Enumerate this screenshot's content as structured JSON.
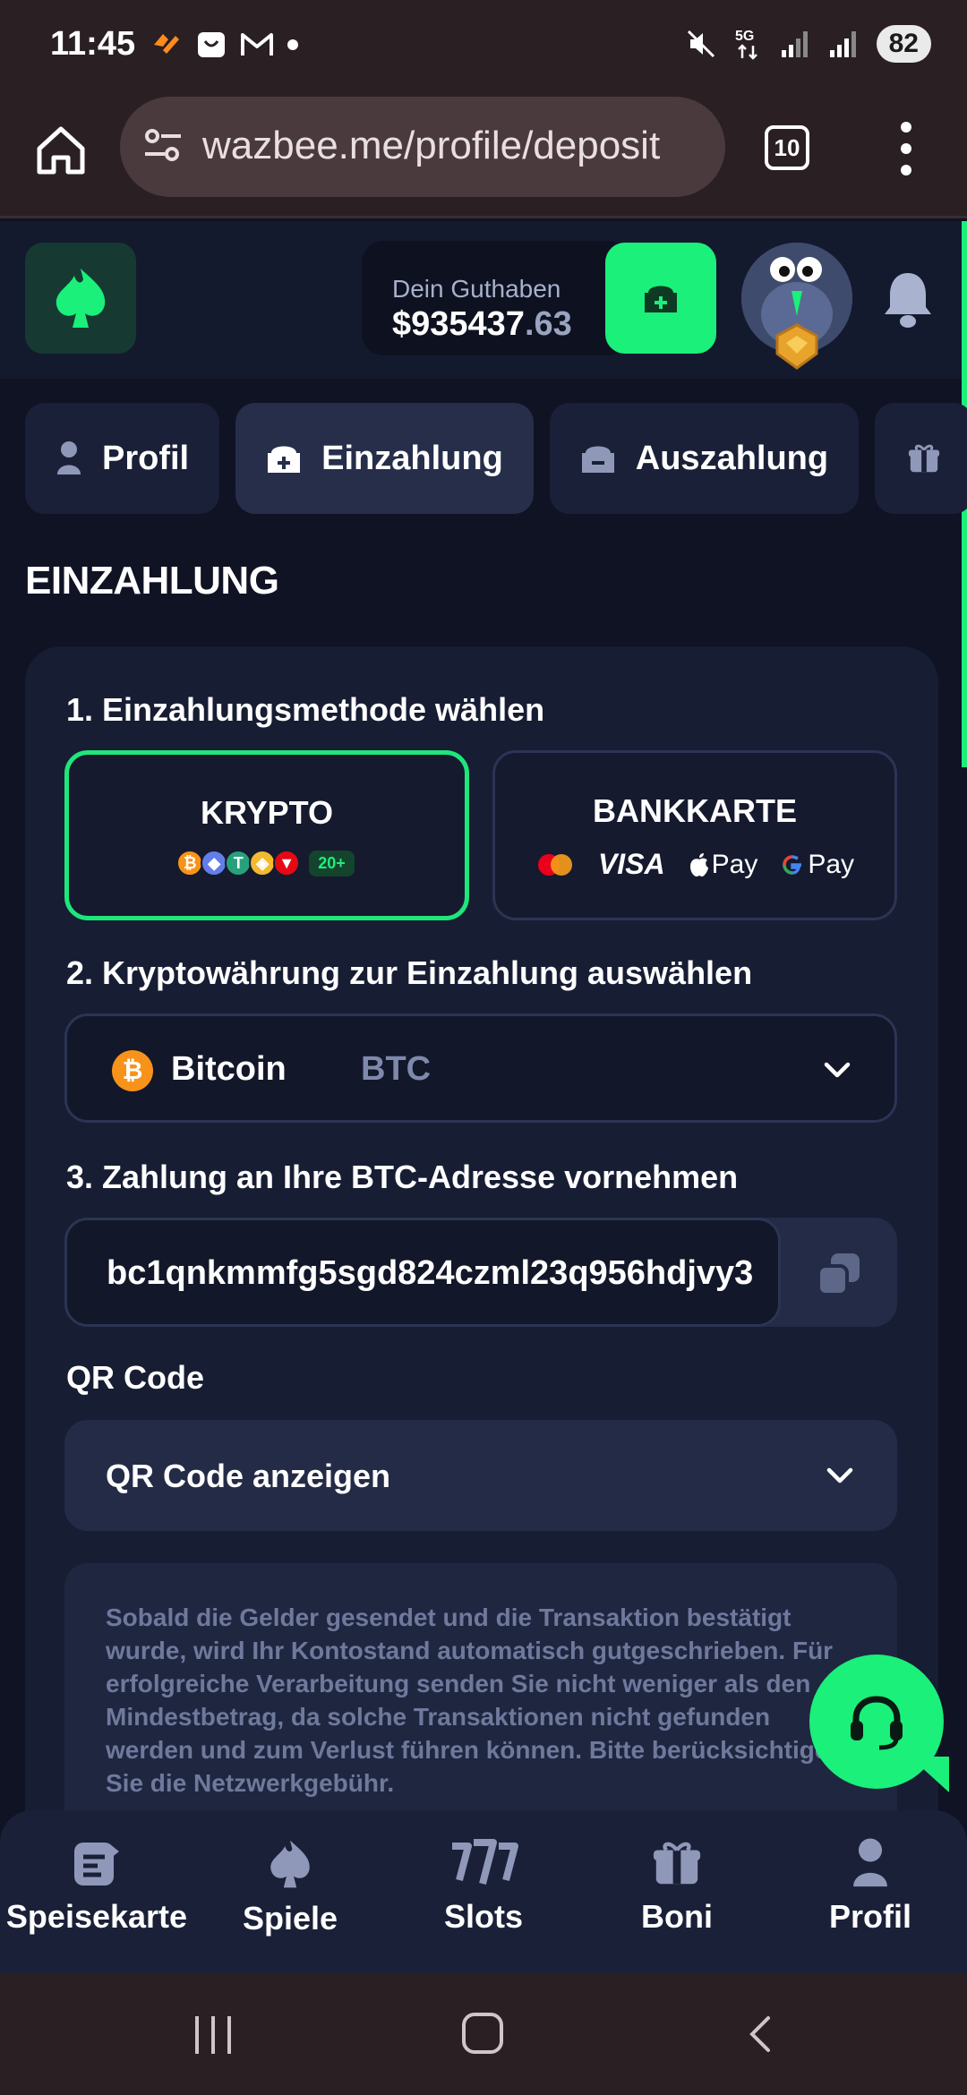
{
  "status_bar": {
    "time": "11:45",
    "network": "5G",
    "battery": "82"
  },
  "browser": {
    "url": "wazbee.me/profile/deposit",
    "tabs_count": "10"
  },
  "header": {
    "balance_label": "Dein Guthaben",
    "balance_main": "$935437",
    "balance_cents": ".63"
  },
  "tabs": [
    {
      "label": "Profil"
    },
    {
      "label": "Einzahlung"
    },
    {
      "label": "Auszahlung"
    }
  ],
  "page_title": "EINZAHLUNG",
  "steps": {
    "step1": "1. Einzahlungsmethode wählen",
    "step2": "2. Kryptowährung zur Einzahlung auswählen",
    "step3": "3. Zahlung an Ihre BTC-Adresse vornehmen"
  },
  "methods": {
    "crypto": {
      "title": "KRYPTO",
      "more": "20+"
    },
    "card": {
      "title": "BANKKARTE",
      "visa": "VISA",
      "apple_pay": "Pay",
      "google_pay": "Pay"
    }
  },
  "currency_select": {
    "name": "Bitcoin",
    "code": "BTC"
  },
  "address": {
    "value": "bc1qnkmmfg5sgd824czml23q956hdjvy3"
  },
  "qr": {
    "label": "QR Code",
    "toggle_label": "QR Code anzeigen"
  },
  "notice": {
    "text": "Sobald die Gelder gesendet und die Transaktion bestätigt wurde, wird Ihr Kontostand automatisch gutgeschrieben. Für erfolgreiche Verarbeitung senden Sie nicht weniger als den Mindestbetrag, da solche Transaktionen nicht gefunden werden und zum Verlust führen können. Bitte berücksichtigen Sie die Netzwerkgebühr."
  },
  "bottom_nav": [
    {
      "label": "Speisekarte"
    },
    {
      "label": "Spiele"
    },
    {
      "label": "Slots"
    },
    {
      "label": "Boni"
    },
    {
      "label": "Profil"
    }
  ],
  "colors": {
    "accent": "#1af07a",
    "background": "#0f1324",
    "card": "#171d33",
    "btc": "#f7931a"
  }
}
